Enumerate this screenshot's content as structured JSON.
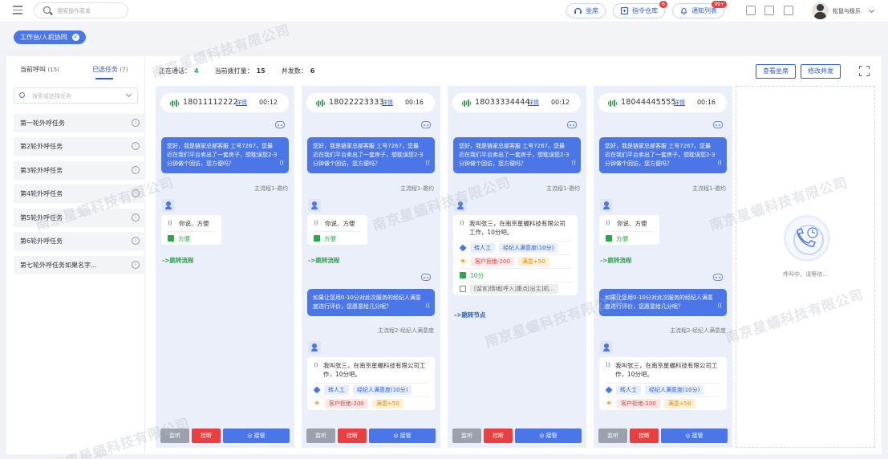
{
  "header": {
    "search_placeholder": "搜索操作菜单",
    "agent_label": "坐席",
    "cmd_label": "指令仓库",
    "cmd_badge": "6",
    "notify_label": "通知列表",
    "notify_badge": "99+",
    "user_name": "松鼠与极乐"
  },
  "work_tab": {
    "label": "工作台/人机协同",
    "close": "×"
  },
  "sidebar": {
    "tab_current": "当前呼叫",
    "tab_current_count": "(15)",
    "tab_selected": "已选任务",
    "tab_selected_count": "(7)",
    "search_placeholder": "搜索或选择任务",
    "tasks": [
      "第一轮外呼任务",
      "第2轮外呼任务",
      "第3轮外呼任务",
      "第4轮外呼任务",
      "第5轮外呼任务",
      "第6轮外呼任务",
      "第七轮外呼任务如果名字..."
    ],
    "info_icon": "i"
  },
  "stats": {
    "talking_label": "正在通话：",
    "talking": "4",
    "dialing_label": "当前拨打量：",
    "dialing": "15",
    "concurrent_label": "并发数：",
    "concurrent": "6"
  },
  "actions": {
    "view_agents": "查看坐席",
    "edit_concurrency": "修改并发"
  },
  "calls": [
    {
      "phone": "18011112222",
      "detail": "详情",
      "time": "00:12"
    },
    {
      "phone": "18022223333",
      "detail": "详情",
      "time": "00:16"
    },
    {
      "phone": "18033334444",
      "detail": "详情",
      "time": "00:12"
    },
    {
      "phone": "18044445555",
      "detail": "详情",
      "time": "00:16"
    }
  ],
  "common": {
    "bot_msg1": "您好，我是链家总部客服 工号7267，您最近在我们平台卖出了一套房子，想耽误您2-3分钟做个回访，您方便吗？",
    "flow1": "主流程1-邀约",
    "user_msg1": "你说、方便",
    "intent1": "方便",
    "jump_flow": "->跳转流程",
    "bot_msg2": "如果让您用0-10分对此次服务的经纪人满意度进行评价，您愿意给几分呢？",
    "flow2": "主流程2-经纪人满意度",
    "user_msg2": "我叫张三，在南京星蝠科技有限公司工作，10分吧。",
    "tag_transfer": "转人工",
    "tag_satisfaction": "经纪人满意度(10分)",
    "tag_reject": "客户拒绝-200",
    "tag_satisfied": "满意+50",
    "tag_score": "10分",
    "tag_more": "[留言]情绪[呼入]重点[出主]机...",
    "jump_node": "->跳转节点",
    "btn_listen": "监听",
    "btn_hangup": "挂断",
    "btn_answer": "接管"
  },
  "waiting": "呼叫中，请等待...",
  "watermark": "南京星蝠科技有限公司"
}
